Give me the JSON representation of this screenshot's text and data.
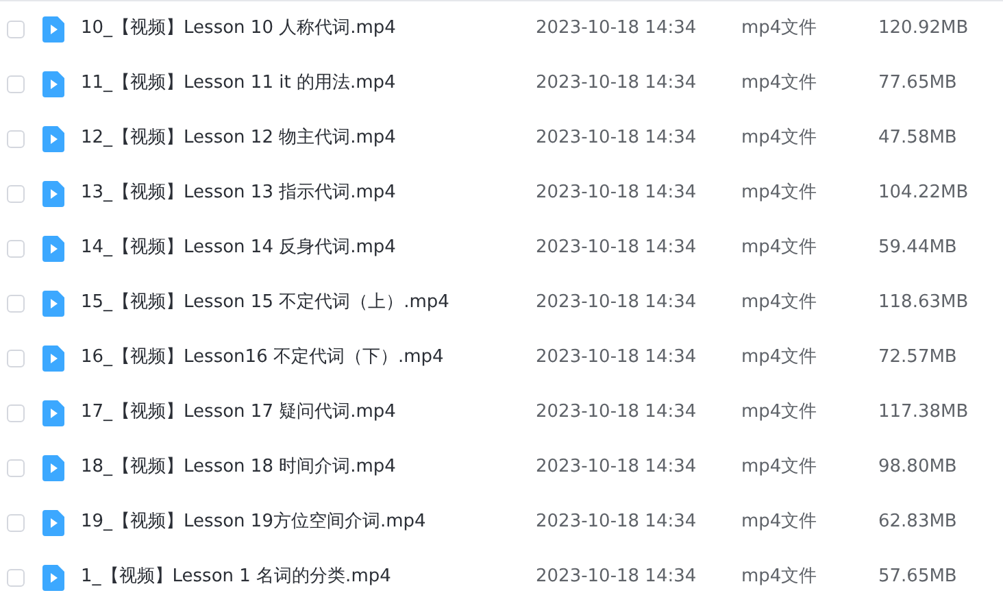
{
  "files": [
    {
      "name": "10_【视频】Lesson 10 人称代词.mp4",
      "modified": "2023-10-18 14:34",
      "type": "mp4文件",
      "size": "120.92MB",
      "checked": false
    },
    {
      "name": "11_【视频】Lesson 11 it 的用法.mp4",
      "modified": "2023-10-18 14:34",
      "type": "mp4文件",
      "size": "77.65MB",
      "checked": false
    },
    {
      "name": "12_【视频】Lesson 12 物主代词.mp4",
      "modified": "2023-10-18 14:34",
      "type": "mp4文件",
      "size": "47.58MB",
      "checked": false
    },
    {
      "name": "13_【视频】Lesson 13 指示代词.mp4",
      "modified": "2023-10-18 14:34",
      "type": "mp4文件",
      "size": "104.22MB",
      "checked": false
    },
    {
      "name": "14_【视频】Lesson 14 反身代词.mp4",
      "modified": "2023-10-18 14:34",
      "type": "mp4文件",
      "size": "59.44MB",
      "checked": false
    },
    {
      "name": "15_【视频】Lesson 15 不定代词（上）.mp4",
      "modified": "2023-10-18 14:34",
      "type": "mp4文件",
      "size": "118.63MB",
      "checked": false
    },
    {
      "name": "16_【视频】Lesson16 不定代词（下）.mp4",
      "modified": "2023-10-18 14:34",
      "type": "mp4文件",
      "size": "72.57MB",
      "checked": false
    },
    {
      "name": "17_【视频】Lesson 17 疑问代词.mp4",
      "modified": "2023-10-18 14:34",
      "type": "mp4文件",
      "size": "117.38MB",
      "checked": false
    },
    {
      "name": "18_【视频】Lesson 18 时间介词.mp4",
      "modified": "2023-10-18 14:34",
      "type": "mp4文件",
      "size": "98.80MB",
      "checked": false
    },
    {
      "name": "19_【视频】Lesson 19方位空间介词.mp4",
      "modified": "2023-10-18 14:34",
      "type": "mp4文件",
      "size": "62.83MB",
      "checked": false
    },
    {
      "name": "1_【视频】Lesson 1 名词的分类.mp4",
      "modified": "2023-10-18 14:34",
      "type": "mp4文件",
      "size": "57.65MB",
      "checked": false
    }
  ]
}
